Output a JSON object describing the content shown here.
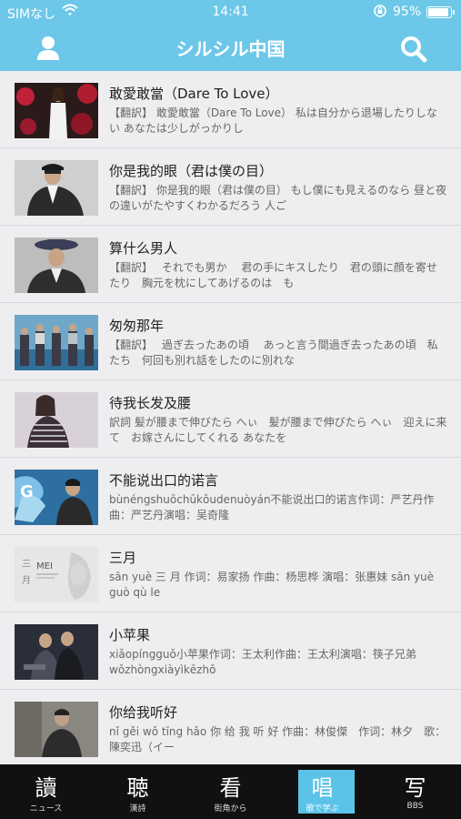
{
  "status_bar": {
    "carrier": "SIMなし",
    "time": "14:41",
    "battery": "95%",
    "battery_level": 0.95
  },
  "nav": {
    "title": "シルシル中国"
  },
  "songs": [
    {
      "title": "敢愛敢當（Dare To Love）",
      "desc": "【翻訳】 敢愛敢當（Dare To Love） 私は自分から退場したりしない あなたは少しがっかりし"
    },
    {
      "title": "你是我的眼（君は僕の目）",
      "desc": "【翻訳】 你是我的眼（君は僕の目） もし僕にも見えるのなら 昼と夜の違いがたやすくわかるだろう 人ご"
    },
    {
      "title": "算什么男人",
      "desc": "【翻訳】　 それでも男か　 君の手にキスしたり　君の頭に顔を寄せたり　胸元を枕にしてあげるのは　も"
    },
    {
      "title": "匆匆那年",
      "desc": "【翻訳】　 過ぎ去ったあの頃　 あっと言う間過ぎ去ったあの頃　私たち　何回も別れ話をしたのに別れな"
    },
    {
      "title": "待我长发及腰",
      "desc": "訳詞 髪が腰まで伸びたら へぃ　髪が腰まで伸びたら へぃ　迎えに来て　お嫁さんにしてくれる あなたを"
    },
    {
      "title": "不能说出口的诺言",
      "desc": "bùnéngshuōchūkǒudenuòyán不能说出口的诺言作词：严艺丹作曲：严艺丹演唱：吴奇隆"
    },
    {
      "title": "三月",
      "desc": "sān yuè 三 月 作词：易家扬 作曲：杨思桦 演唱：张惠妹 sān yuè guò qù le"
    },
    {
      "title": "小苹果",
      "desc": "xiǎopíngguǒ小苹果作词：王太利作曲：王太利演唱：筷子兄弟 wǒzhòngxiàyìkēzhǒ"
    },
    {
      "title": "你给我听好",
      "desc": "nǐ gěi wǒ tīng hǎo 你 给 我 听 好 作曲：林俊傑　作词：林夕　歌：陳奕迅（イー"
    }
  ],
  "thumb_text": {
    "mei_caption": "MEI"
  },
  "tabs": [
    {
      "glyph": "讀",
      "label": "ニュース",
      "active": false
    },
    {
      "glyph": "聴",
      "label": "漢詩",
      "active": false
    },
    {
      "glyph": "看",
      "label": "街角から",
      "active": false
    },
    {
      "glyph": "唱",
      "label": "歌で学ぶ",
      "active": true
    },
    {
      "glyph": "写",
      "label": "BBS",
      "active": false
    }
  ],
  "colors": {
    "brand": "#6cc7e9",
    "active_tab": "#5bc3e8",
    "tab_bar": "#111111"
  }
}
